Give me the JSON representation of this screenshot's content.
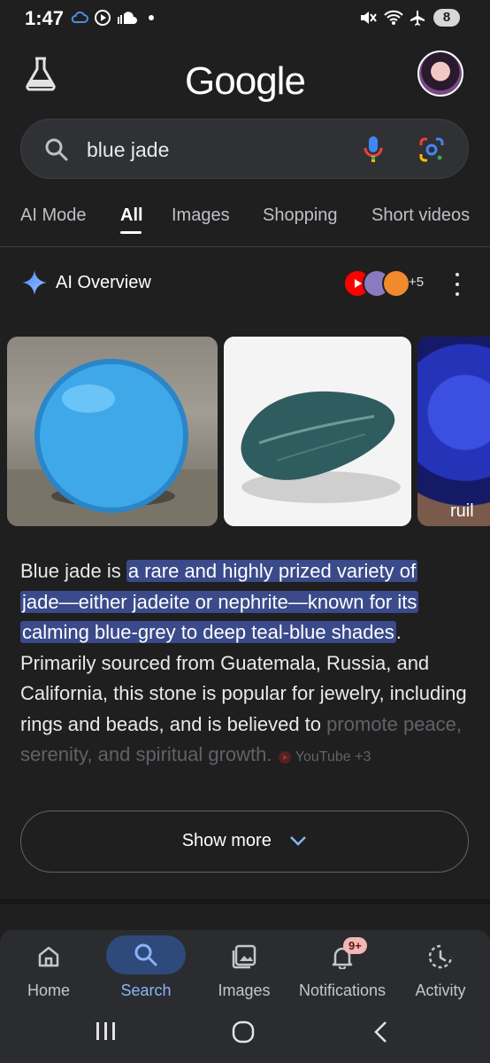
{
  "status_bar": {
    "time": "1:47",
    "battery": "8"
  },
  "header": {
    "logo": "Google"
  },
  "search": {
    "query": "blue jade"
  },
  "tabs": [
    "AI Mode",
    "All",
    "Images",
    "Shopping",
    "Short videos"
  ],
  "ai_overview": {
    "title": "AI Overview",
    "sources_more": "+5",
    "image_overlay_text": "ruil",
    "answer": {
      "lead": "Blue jade is ",
      "highlight_1": "a rare and highly prized variety of",
      "highlight_2": "jade—either jadeite or nephrite—known for its",
      "highlight_3": "calming blue-grey to deep teal-blue shades",
      "after_highlight": ".",
      "body": "Primarily sourced from Guatemala, Russia, and California, this stone is popular for jewelry, including rings and beads, and is believed to",
      "faded": "promote peace, serenity, and spiritual growth.",
      "inline_source": "YouTube +3"
    },
    "show_more": "Show more"
  },
  "bottom_nav": {
    "items": [
      {
        "label": "Home",
        "icon": "home-icon"
      },
      {
        "label": "Search",
        "icon": "search-icon"
      },
      {
        "label": "Images",
        "icon": "images-icon"
      },
      {
        "label": "Notifications",
        "icon": "bell-icon",
        "badge": "9+"
      },
      {
        "label": "Activity",
        "icon": "activity-icon"
      }
    ],
    "active": "Search"
  },
  "colors": {
    "background": "#1f1f1f",
    "accent": "#8ab4f8",
    "highlight": "#3a4a8a"
  }
}
